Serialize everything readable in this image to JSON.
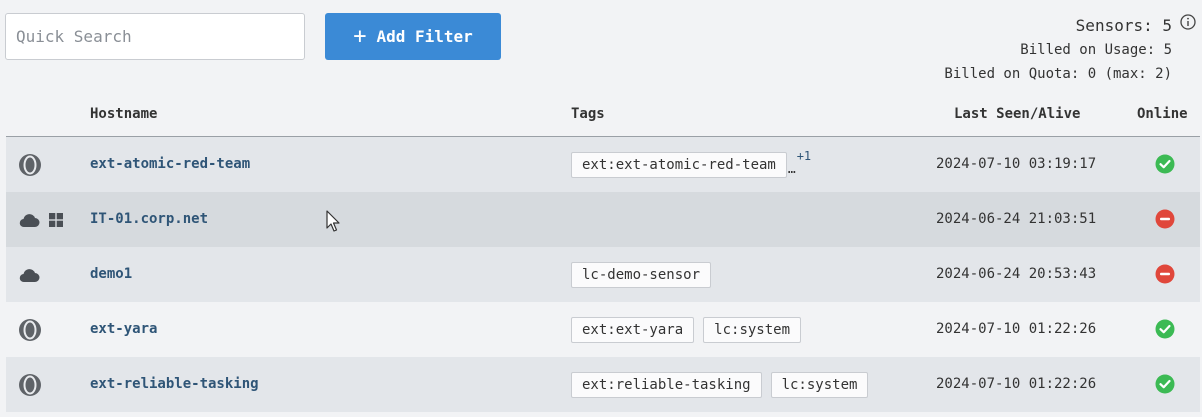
{
  "search": {
    "placeholder": "Quick Search",
    "value": ""
  },
  "toolbar": {
    "add_filter_label": "Add Filter",
    "add_filter_icon": "+"
  },
  "summary": {
    "sensors": "Sensors: 5",
    "billed_usage": "Billed on Usage: 5",
    "billed_quota": "Billed on Quota: 0 (max: 2)"
  },
  "table": {
    "headers": {
      "hostname": "Hostname",
      "tags": "Tags",
      "last_seen": "Last Seen/Alive",
      "online": "Online"
    },
    "rows": [
      {
        "hostname": "ext-atomic-red-team",
        "icons": [
          "extension-icon"
        ],
        "tags": [
          "ext:ext-atomic-red-team"
        ],
        "tag_overflow": "…",
        "more_tags": "+1",
        "last_seen": "2024-07-10 03:19:17",
        "online": true
      },
      {
        "hostname": "IT-01.corp.net",
        "icons": [
          "cloud-icon",
          "windows-icon"
        ],
        "tags": [],
        "tag_overflow": "",
        "more_tags": "",
        "last_seen": "2024-06-24 21:03:51",
        "online": false
      },
      {
        "hostname": "demo1",
        "icons": [
          "cloud-icon"
        ],
        "tags": [
          "lc-demo-sensor"
        ],
        "tag_overflow": "",
        "more_tags": "",
        "last_seen": "2024-06-24 20:53:43",
        "online": false
      },
      {
        "hostname": "ext-yara",
        "icons": [
          "extension-icon"
        ],
        "tags": [
          "ext:ext-yara",
          "lc:system"
        ],
        "tag_overflow": "",
        "more_tags": "",
        "last_seen": "2024-07-10 01:22:26",
        "online": true
      },
      {
        "hostname": "ext-reliable-tasking",
        "icons": [
          "extension-icon"
        ],
        "tags": [
          "ext:reliable-tasking",
          "lc:system"
        ],
        "tag_overflow": "",
        "more_tags": "",
        "last_seen": "2024-07-10 01:22:26",
        "online": true
      }
    ]
  },
  "colors": {
    "accent": "#3b8ad6",
    "online": "#3cba54",
    "offline": "#e0473b",
    "hostname": "#2f5577"
  }
}
